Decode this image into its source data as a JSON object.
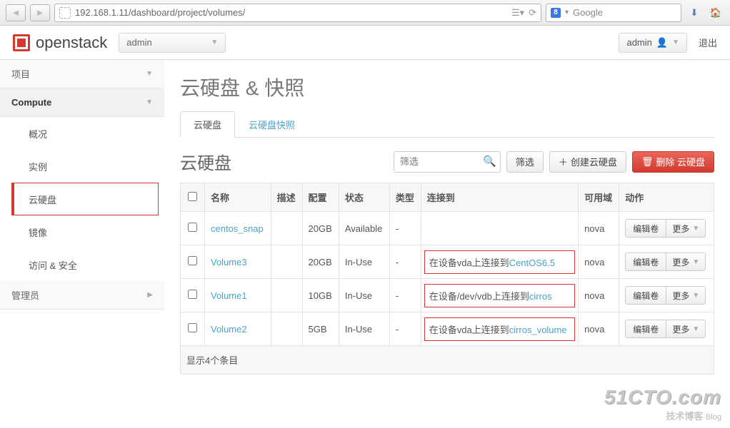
{
  "browser": {
    "url": "192.168.1.11/dashboard/project/volumes/",
    "search_engine": "Google",
    "search_prefix": "8"
  },
  "topbar": {
    "brand": "openstack",
    "tenant": "admin",
    "user": "admin",
    "logout": "退出"
  },
  "sidebar": {
    "project": "项目",
    "compute": "Compute",
    "items": [
      "概况",
      "实例",
      "云硬盘",
      "镜像",
      "访问 & 安全"
    ],
    "admin": "管理员"
  },
  "page": {
    "title": "云硬盘 & 快照",
    "tabs": [
      "云硬盘",
      "云硬盘快照"
    ],
    "section_title": "云硬盘",
    "filter_placeholder": "筛选",
    "filter_btn": "筛选",
    "create_btn": "创建云硬盘",
    "delete_btn": "删除 云硬盘",
    "columns": [
      "",
      "名称",
      "描述",
      "配置",
      "状态",
      "类型",
      "连接到",
      "可用域",
      "动作"
    ],
    "edit_label": "编辑卷",
    "more_label": "更多",
    "footer": "显示4个条目"
  },
  "rows": [
    {
      "name": "centos_snap",
      "desc": "",
      "size": "20GB",
      "status": "Available",
      "type": "-",
      "attach_prefix": "",
      "attach_link": "",
      "zone": "nova"
    },
    {
      "name": "Volume3",
      "desc": "",
      "size": "20GB",
      "status": "In-Use",
      "type": "-",
      "attach_prefix": "在设备vda上连接到",
      "attach_link": "CentOS6.5",
      "zone": "nova"
    },
    {
      "name": "Volume1",
      "desc": "",
      "size": "10GB",
      "status": "In-Use",
      "type": "-",
      "attach_prefix": "在设备/dev/vdb上连接到",
      "attach_link": "cirros",
      "zone": "nova"
    },
    {
      "name": "Volume2",
      "desc": "",
      "size": "5GB",
      "status": "In-Use",
      "type": "-",
      "attach_prefix": "在设备vda上连接到",
      "attach_link": "cirros_volume",
      "zone": "nova"
    }
  ],
  "watermark": {
    "big": "51CTO.com",
    "small": "技术博客",
    "blog": "Blog"
  }
}
